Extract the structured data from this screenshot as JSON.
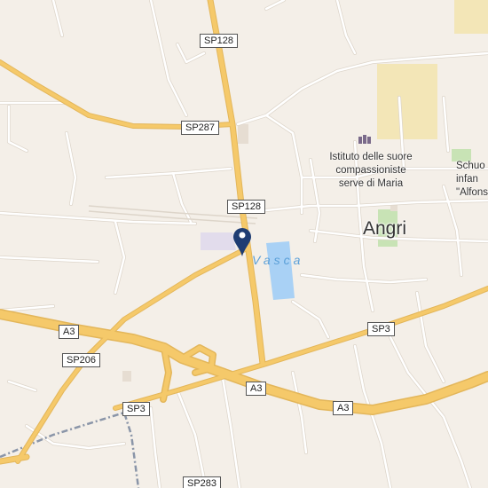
{
  "map": {
    "colors": {
      "background": "#f4efe8",
      "major_road": "#f5c96a",
      "minor_road": "#ffffff",
      "road_casing": "#ddd5ca",
      "water": "#a9d1f5",
      "park": "#c8e3b5",
      "school_area": "#f3e6b7",
      "railway": "#8a95a8",
      "pin": "#1f3d73"
    },
    "road_labels": {
      "sp128_north": "SP128",
      "sp287": "SP287",
      "sp128_mid": "SP128",
      "a3_west": "A3",
      "sp206": "SP206",
      "a3_center": "A3",
      "sp3_east": "SP3",
      "a3_east": "A3",
      "sp3_west": "SP3",
      "sp283": "SP283"
    },
    "places": {
      "town": "Angri",
      "water": "Vasca"
    },
    "pois": {
      "institute_line1": "Istituto delle suore",
      "institute_line2": "compassioniste",
      "institute_line3": "serve di Maria",
      "school_line1": "Schuo",
      "school_line2": "infan",
      "school_line3": "\"Alfons"
    },
    "icons": {
      "marker": "map-pin-icon",
      "institute": "building-icon"
    }
  }
}
